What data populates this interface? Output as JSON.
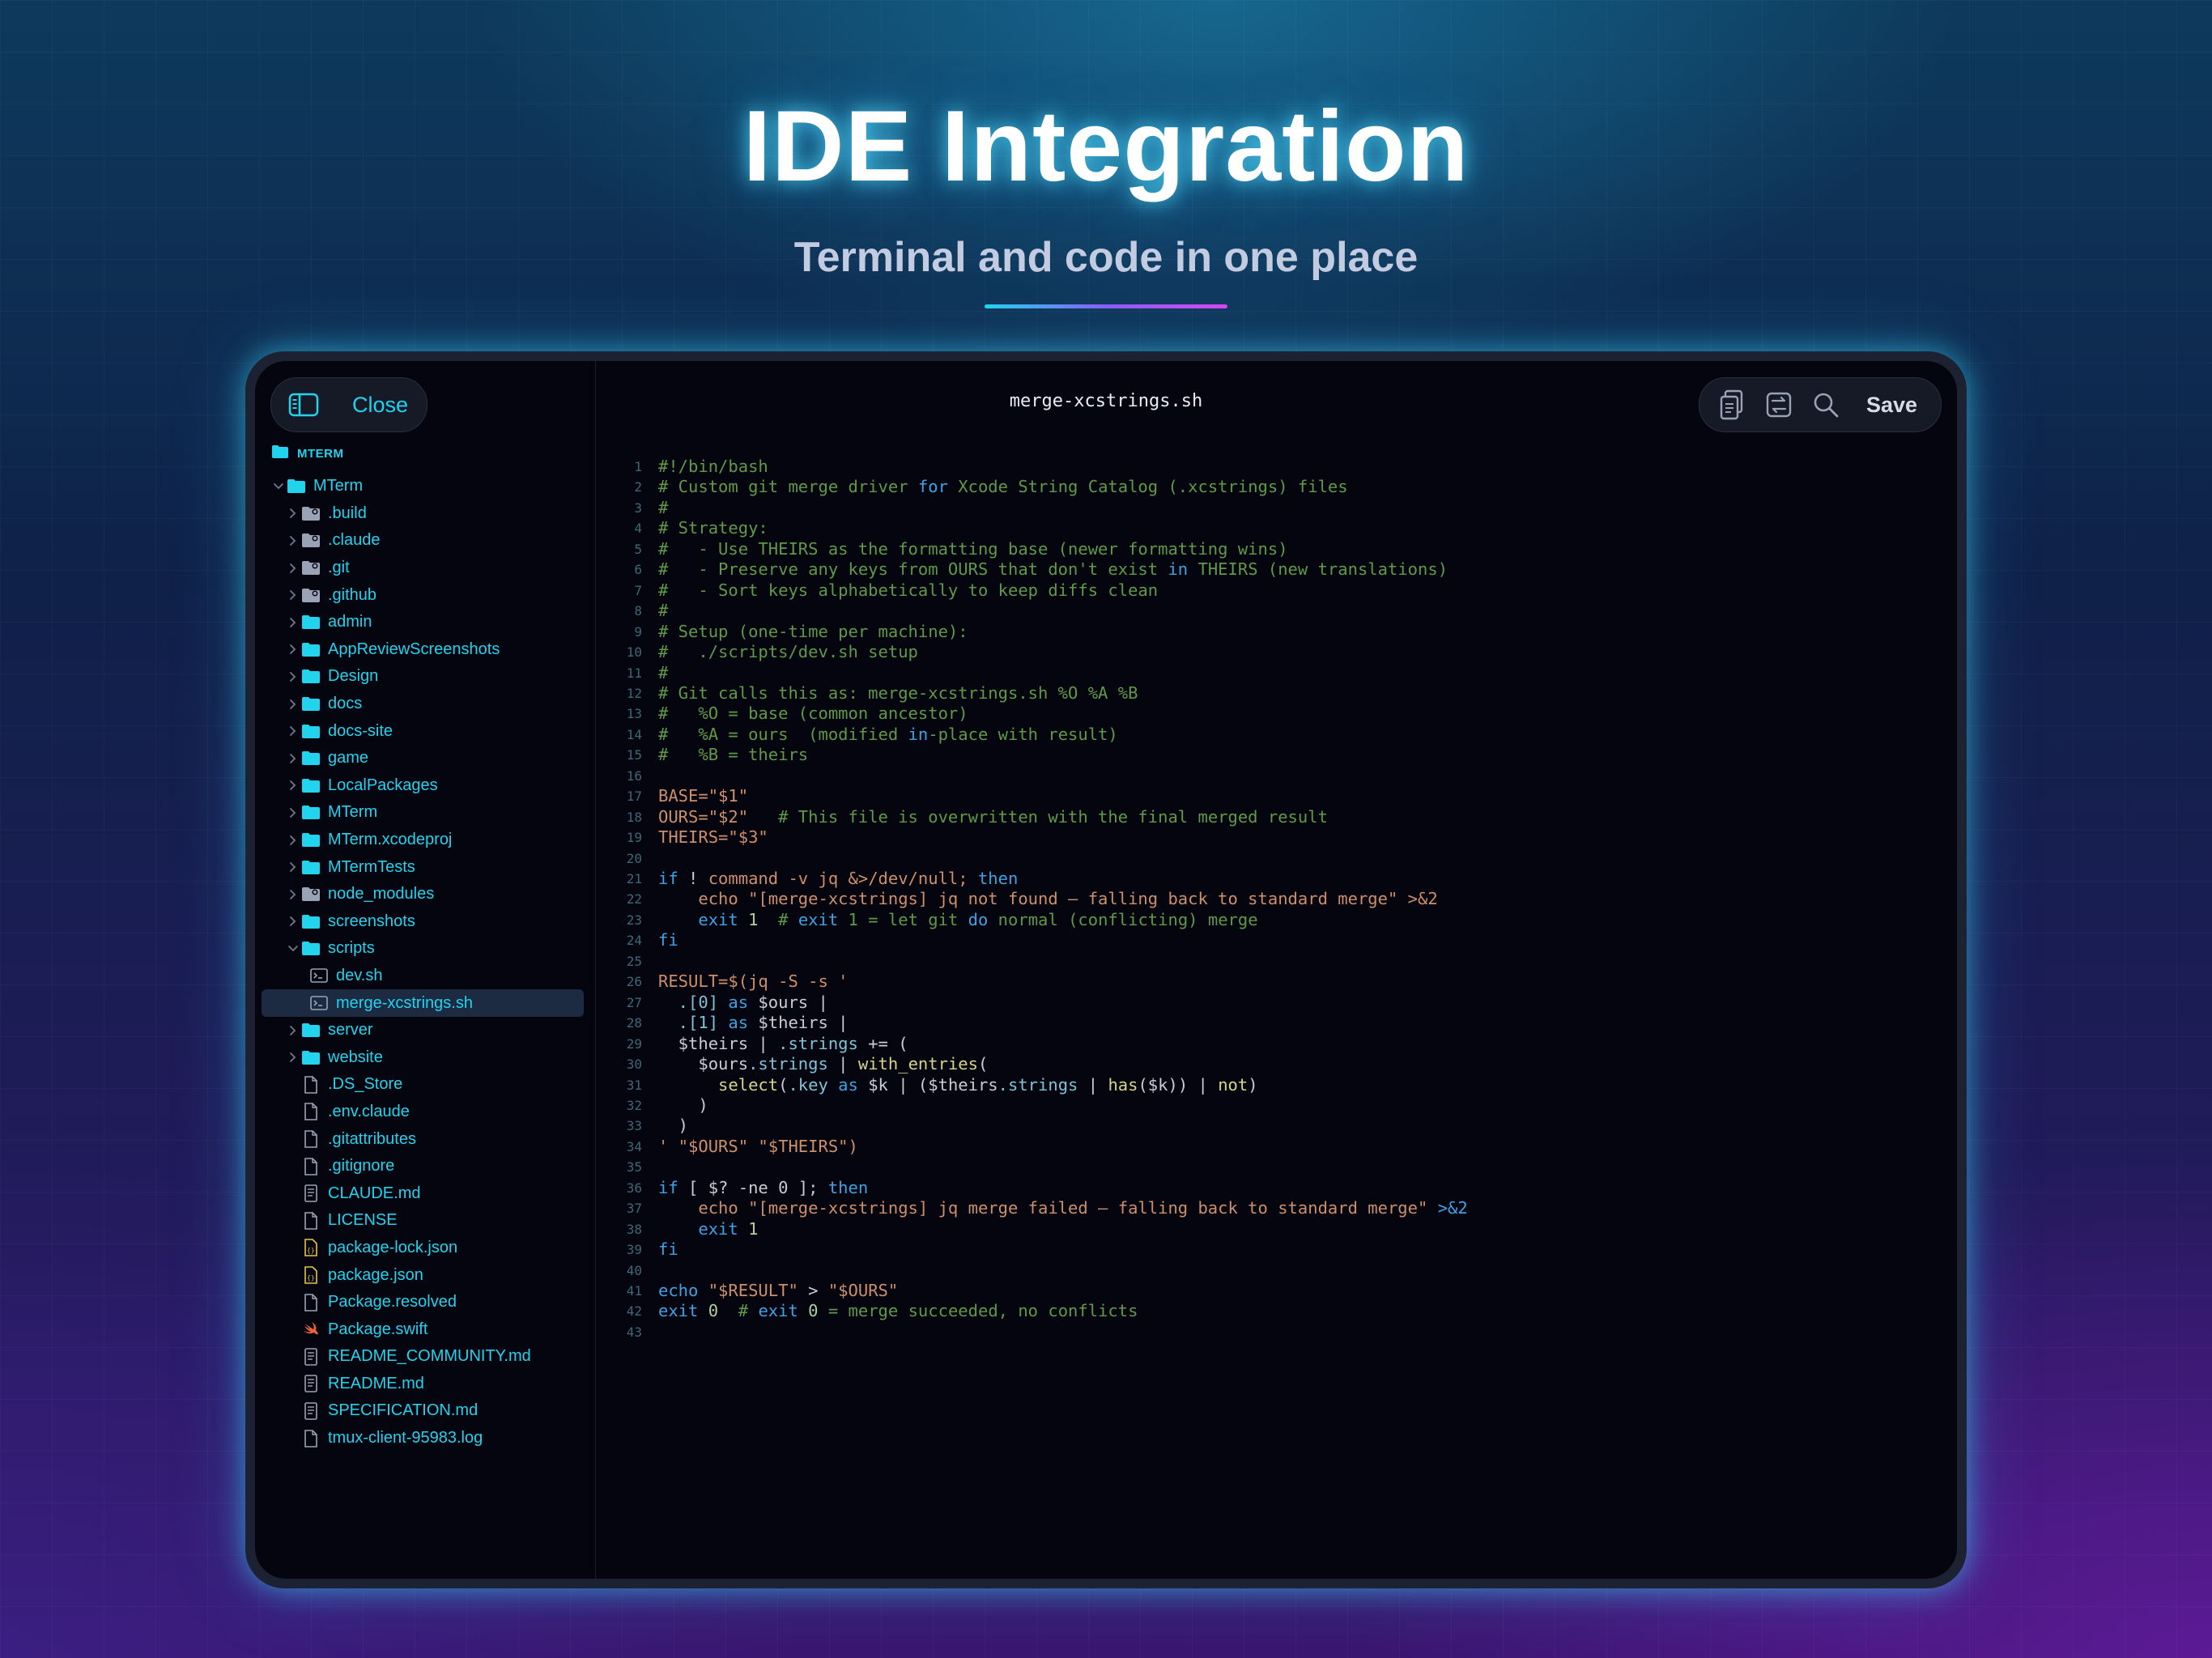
{
  "hero": {
    "title": "IDE Integration",
    "subtitle": "Terminal and code in one place"
  },
  "toolbar": {
    "close_label": "Close",
    "file_title": "merge-xcstrings.sh",
    "save_label": "Save",
    "icons": [
      "sidebar-toggle-icon",
      "copy-icon",
      "swap-icon",
      "search-icon"
    ]
  },
  "sidebar": {
    "root_label": "MTERM",
    "items": [
      {
        "label": "MTerm",
        "type": "folder",
        "depth": 0,
        "expanded": true
      },
      {
        "label": ".build",
        "type": "folder-special",
        "depth": 1
      },
      {
        "label": ".claude",
        "type": "folder-special",
        "depth": 1
      },
      {
        "label": ".git",
        "type": "folder-special",
        "depth": 1
      },
      {
        "label": ".github",
        "type": "folder-special",
        "depth": 1
      },
      {
        "label": "admin",
        "type": "folder",
        "depth": 1
      },
      {
        "label": "AppReviewScreenshots",
        "type": "folder",
        "depth": 1
      },
      {
        "label": "Design",
        "type": "folder",
        "depth": 1
      },
      {
        "label": "docs",
        "type": "folder",
        "depth": 1
      },
      {
        "label": "docs-site",
        "type": "folder",
        "depth": 1
      },
      {
        "label": "game",
        "type": "folder",
        "depth": 1
      },
      {
        "label": "LocalPackages",
        "type": "folder",
        "depth": 1
      },
      {
        "label": "MTerm",
        "type": "folder",
        "depth": 1
      },
      {
        "label": "MTerm.xcodeproj",
        "type": "folder",
        "depth": 1
      },
      {
        "label": "MTermTests",
        "type": "folder",
        "depth": 1
      },
      {
        "label": "node_modules",
        "type": "folder-special",
        "depth": 1
      },
      {
        "label": "screenshots",
        "type": "folder",
        "depth": 1
      },
      {
        "label": "scripts",
        "type": "folder",
        "depth": 1,
        "expanded": true
      },
      {
        "label": "dev.sh",
        "type": "script",
        "depth": 2
      },
      {
        "label": "merge-xcstrings.sh",
        "type": "script",
        "depth": 2,
        "selected": true
      },
      {
        "label": "server",
        "type": "folder",
        "depth": 1
      },
      {
        "label": "website",
        "type": "folder",
        "depth": 1
      },
      {
        "label": ".DS_Store",
        "type": "file",
        "depth": 1
      },
      {
        "label": ".env.claude",
        "type": "file",
        "depth": 1
      },
      {
        "label": ".gitattributes",
        "type": "file",
        "depth": 1
      },
      {
        "label": ".gitignore",
        "type": "file",
        "depth": 1
      },
      {
        "label": "CLAUDE.md",
        "type": "doc",
        "depth": 1
      },
      {
        "label": "LICENSE",
        "type": "file",
        "depth": 1
      },
      {
        "label": "package-lock.json",
        "type": "json",
        "depth": 1
      },
      {
        "label": "package.json",
        "type": "json",
        "depth": 1
      },
      {
        "label": "Package.resolved",
        "type": "file",
        "depth": 1
      },
      {
        "label": "Package.swift",
        "type": "swift",
        "depth": 1
      },
      {
        "label": "README_COMMUNITY.md",
        "type": "doc",
        "depth": 1
      },
      {
        "label": "README.md",
        "type": "doc",
        "depth": 1
      },
      {
        "label": "SPECIFICATION.md",
        "type": "doc",
        "depth": 1
      },
      {
        "label": "tmux-client-95983.log",
        "type": "file",
        "depth": 1
      }
    ]
  },
  "editor": {
    "lines": [
      [
        [
          "cm",
          "#!/bin/bash"
        ]
      ],
      [
        [
          "cm",
          "# Custom git merge driver "
        ],
        [
          "kw",
          "for"
        ],
        [
          "cm",
          " Xcode String Catalog (.xcstrings) files"
        ]
      ],
      [
        [
          "cm",
          "#"
        ]
      ],
      [
        [
          "cm",
          "# Strategy:"
        ]
      ],
      [
        [
          "cm",
          "#   - Use THEIRS as the formatting base (newer formatting wins)"
        ]
      ],
      [
        [
          "cm",
          "#   - Preserve any keys from OURS that don't exist "
        ],
        [
          "kw",
          "in"
        ],
        [
          "cm",
          " THEIRS (new translations)"
        ]
      ],
      [
        [
          "cm",
          "#   - Sort keys alphabetically to keep diffs clean"
        ]
      ],
      [
        [
          "cm",
          "#"
        ]
      ],
      [
        [
          "cm",
          "# Setup (one-time per machine):"
        ]
      ],
      [
        [
          "cm",
          "#   ./scripts/dev.sh setup"
        ]
      ],
      [
        [
          "cm",
          "#"
        ]
      ],
      [
        [
          "cm",
          "# Git calls this as: merge-xcstrings.sh %O %A %B"
        ]
      ],
      [
        [
          "cm",
          "#   %O = base (common ancestor)"
        ]
      ],
      [
        [
          "cm",
          "#   %A = ours  (modified "
        ],
        [
          "kw",
          "in"
        ],
        [
          "cm",
          "-place with result)"
        ]
      ],
      [
        [
          "cm",
          "#   %B = theirs"
        ]
      ],
      [],
      [
        [
          "st",
          "BASE=\"$1\""
        ]
      ],
      [
        [
          "st",
          "OURS=\"$2\"   "
        ],
        [
          "cm",
          "# This file is overwritten with the final merged result"
        ]
      ],
      [
        [
          "st",
          "THEIRS=\"$3\""
        ]
      ],
      [],
      [
        [
          "kw",
          "if"
        ],
        [
          "df",
          " ! "
        ],
        [
          "st",
          "command -v jq &>/dev/null; "
        ],
        [
          "kw",
          "then"
        ]
      ],
      [
        [
          "st",
          "    echo \"[merge-xcstrings] jq not found — falling back to standard merge\" >&2"
        ]
      ],
      [
        [
          "kw",
          "    exit"
        ],
        [
          "nm",
          " 1  "
        ],
        [
          "cm",
          "# "
        ],
        [
          "kw",
          "exit"
        ],
        [
          "cm",
          " 1 = let git "
        ],
        [
          "kw",
          "do"
        ],
        [
          "cm",
          " normal (conflicting) merge"
        ]
      ],
      [
        [
          "kw",
          "fi"
        ]
      ],
      [],
      [
        [
          "st",
          "RESULT=$(jq -S -s '"
        ]
      ],
      [
        [
          "vr",
          "  .[0] "
        ],
        [
          "kw",
          "as"
        ],
        [
          "df",
          " $ours |"
        ]
      ],
      [
        [
          "vr",
          "  .[1] "
        ],
        [
          "kw",
          "as"
        ],
        [
          "df",
          " $theirs |"
        ]
      ],
      [
        [
          "df",
          "  $theirs | "
        ],
        [
          "vr",
          ".strings"
        ],
        [
          "df",
          " += ("
        ]
      ],
      [
        [
          "df",
          "    $ours"
        ],
        [
          "vr",
          ".strings"
        ],
        [
          "df",
          " | "
        ],
        [
          "fn",
          "with_entries"
        ],
        [
          "df",
          "("
        ]
      ],
      [
        [
          "fn",
          "      select"
        ],
        [
          "df",
          "("
        ],
        [
          "vr",
          ".key"
        ],
        [
          "kw",
          " as"
        ],
        [
          "df",
          " $k | ($theirs"
        ],
        [
          "vr",
          ".strings"
        ],
        [
          "df",
          " | "
        ],
        [
          "fn",
          "has"
        ],
        [
          "df",
          "($k)) | "
        ],
        [
          "fn",
          "not"
        ],
        [
          "df",
          ")"
        ]
      ],
      [
        [
          "df",
          "    )"
        ]
      ],
      [
        [
          "df",
          "  )"
        ]
      ],
      [
        [
          "st",
          "' \"$OURS\" \"$THEIRS\")"
        ]
      ],
      [],
      [
        [
          "kw",
          "if"
        ],
        [
          "df",
          " [ $? -ne 0 ]; "
        ],
        [
          "kw",
          "then"
        ]
      ],
      [
        [
          "st",
          "    echo \"[merge-xcstrings] jq merge failed — falling back to standard merge\" "
        ],
        [
          "kw",
          ">&2"
        ]
      ],
      [
        [
          "kw",
          "    exit"
        ],
        [
          "nm",
          " 1"
        ]
      ],
      [
        [
          "kw",
          "fi"
        ]
      ],
      [],
      [
        [
          "kw",
          "echo"
        ],
        [
          "st",
          " \"$RESULT\""
        ],
        [
          "df",
          " > "
        ],
        [
          "st",
          "\"$OURS\""
        ]
      ],
      [
        [
          "kw",
          "exit"
        ],
        [
          "nm",
          " 0  "
        ],
        [
          "cm",
          "# "
        ],
        [
          "kw",
          "exit"
        ],
        [
          "nm",
          " 0"
        ],
        [
          "cm",
          " = merge succeeded, no conflicts"
        ]
      ],
      []
    ]
  },
  "colors": {
    "accent": "#22d3ee",
    "comment": "#5f9a47",
    "keyword": "#3ea2e6",
    "string": "#ce8f6a",
    "variable": "#7fc3d6",
    "function": "#d7d48c",
    "default": "#c8ccd8",
    "number": "#b3cea1",
    "editor_bg": "#05050f"
  }
}
